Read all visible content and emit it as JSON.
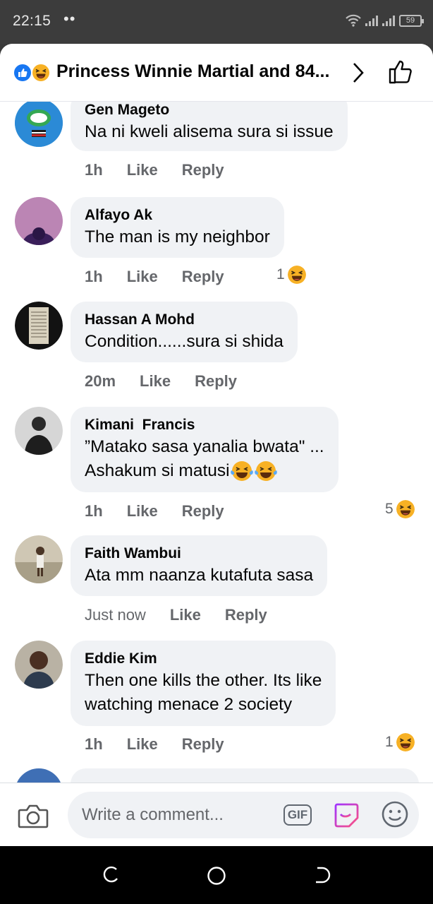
{
  "status_bar": {
    "time": "22:15",
    "dots": "••",
    "battery": "59"
  },
  "header": {
    "title": "Princess Winnie Martial and 84...",
    "reactions": [
      "like-icon",
      "haha-icon"
    ]
  },
  "comments": [
    {
      "name": "Gen Mageto",
      "lines": [
        "Na ni kweli alisema sura si issue"
      ],
      "time": "1h",
      "like": "Like",
      "reply": "Reply",
      "reaction_count": ""
    },
    {
      "name": "Alfayo Ak",
      "lines": [
        "The man is my neighbor"
      ],
      "time": "1h",
      "like": "Like",
      "reply": "Reply",
      "reaction_count": "1"
    },
    {
      "name": "Hassan A Mohd",
      "lines": [
        "Condition......sura si shida"
      ],
      "time": "20m",
      "like": "Like",
      "reply": "Reply",
      "reaction_count": ""
    },
    {
      "name": "Kimani  Francis",
      "lines": [
        "”Matako sasa yanalia bwata\"  ...",
        "Ashakum si matusi"
      ],
      "time": "1h",
      "like": "Like",
      "reply": "Reply",
      "reaction_count": "5"
    },
    {
      "name": "Faith Wambui",
      "lines": [
        "Ata mm naanza kutafuta sasa"
      ],
      "time": "Just now",
      "like": "Like",
      "reply": "Reply",
      "reaction_count": ""
    },
    {
      "name": "Eddie Kim",
      "lines": [
        "Then one kills the other. Its like",
        "watching menace 2 society"
      ],
      "time": "1h",
      "like": "Like",
      "reply": "Reply",
      "reaction_count": "1"
    }
  ],
  "composer": {
    "placeholder": "Write a comment...",
    "gif_label": "GIF"
  },
  "colors": {
    "accent": "#1877f2",
    "bubble": "#f0f2f5",
    "muted": "#65676b",
    "haha": "#f7b125"
  }
}
